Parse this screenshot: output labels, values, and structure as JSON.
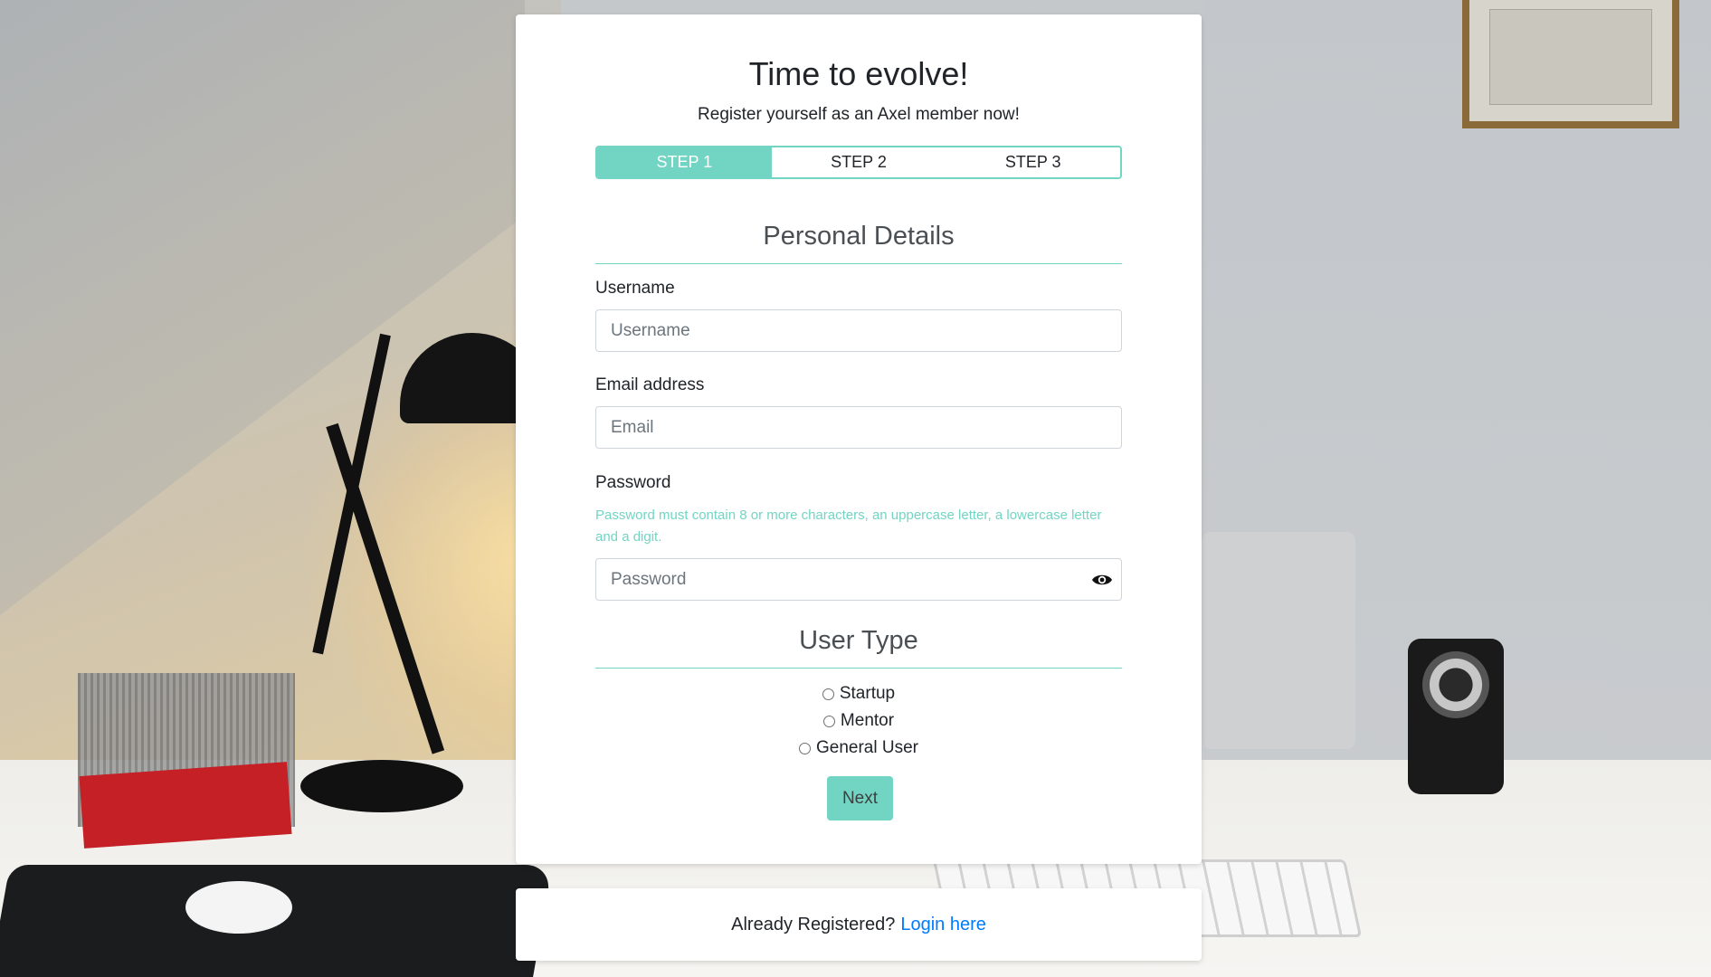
{
  "page": {
    "title": "Time to evolve!",
    "subtitle": "Register yourself as an Axel member now!"
  },
  "steps": [
    {
      "label": "STEP 1",
      "active": true
    },
    {
      "label": "STEP 2",
      "active": false
    },
    {
      "label": "STEP 3",
      "active": false
    }
  ],
  "personal_details": {
    "heading": "Personal Details",
    "username": {
      "label": "Username",
      "placeholder": "Username",
      "value": ""
    },
    "email": {
      "label": "Email address",
      "placeholder": "Email",
      "value": ""
    },
    "password": {
      "label": "Password",
      "hint": "Password must contain 8 or more characters, an uppercase letter, a lowercase letter and a digit.",
      "placeholder": "Password",
      "value": "",
      "toggle_icon": "eye-icon"
    }
  },
  "user_type": {
    "heading": "User Type",
    "options": [
      {
        "label": "Startup",
        "selected": false
      },
      {
        "label": "Mentor",
        "selected": false
      },
      {
        "label": "General User",
        "selected": false
      }
    ]
  },
  "actions": {
    "next_label": "Next"
  },
  "footer": {
    "text": "Already Registered?",
    "link_label": "Login here"
  },
  "colors": {
    "accent": "#72d5c4",
    "link": "#007bff",
    "text": "#212529"
  }
}
